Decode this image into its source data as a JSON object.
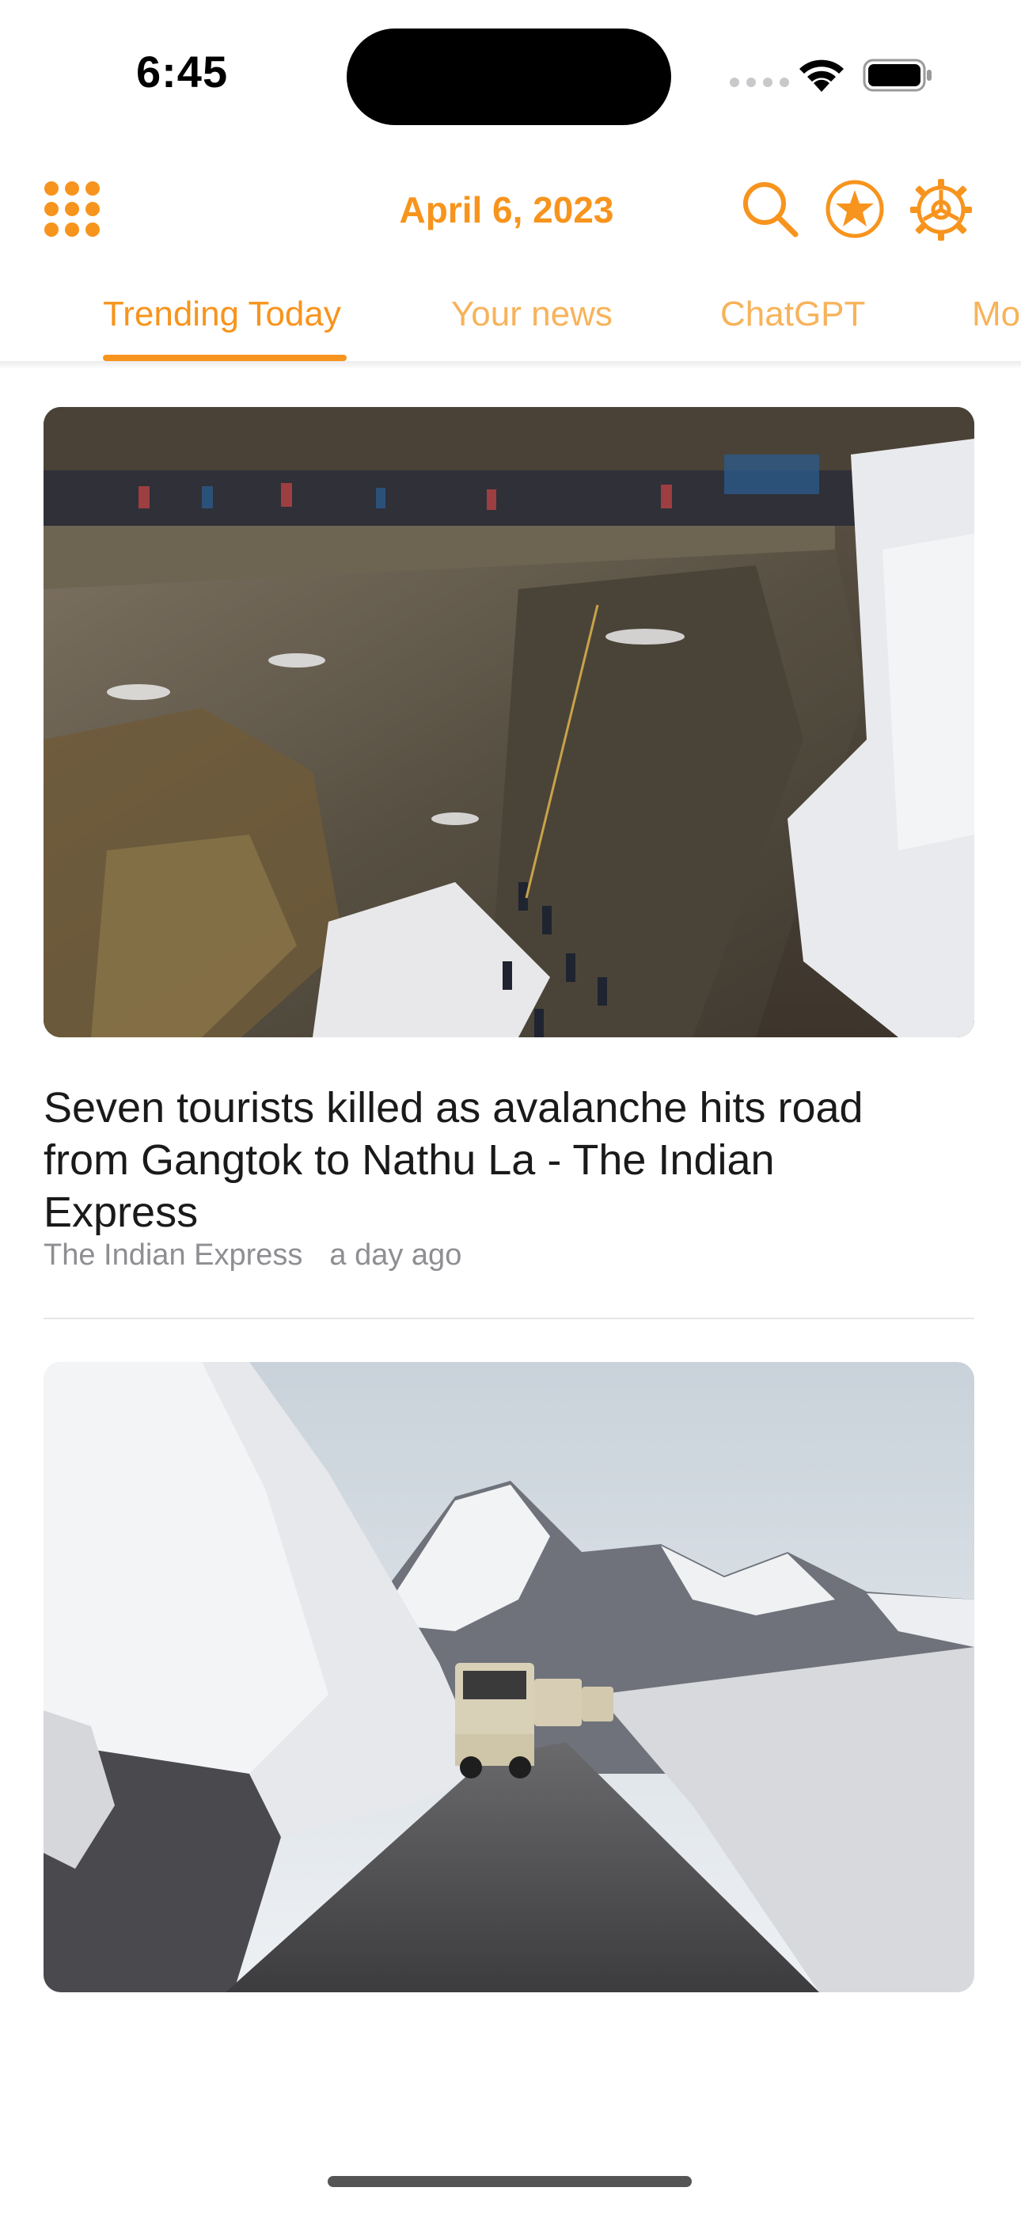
{
  "status_bar": {
    "time": "6:45"
  },
  "header": {
    "date": "April 6, 2023",
    "accent_color": "#f7941d",
    "icons": [
      "apps-grid-icon",
      "search-icon",
      "favorites-star-icon",
      "settings-gear-icon"
    ]
  },
  "tabs": [
    {
      "label": "Trending Today",
      "active": true
    },
    {
      "label": "Your news",
      "active": false
    },
    {
      "label": "ChatGPT",
      "active": false
    },
    {
      "label": "Mo",
      "active": false
    }
  ],
  "articles": [
    {
      "title": "Seven tourists killed as avalanche hits road from Gangtok to Nathu La - The Indian Express",
      "source": "The Indian Express",
      "time_ago": "a day ago",
      "image": "photo of people gathered on a snowy mountain road above a rocky gorge"
    },
    {
      "image": "photo of vehicles driving on a road between high snow walls with snowy mountains"
    }
  ]
}
